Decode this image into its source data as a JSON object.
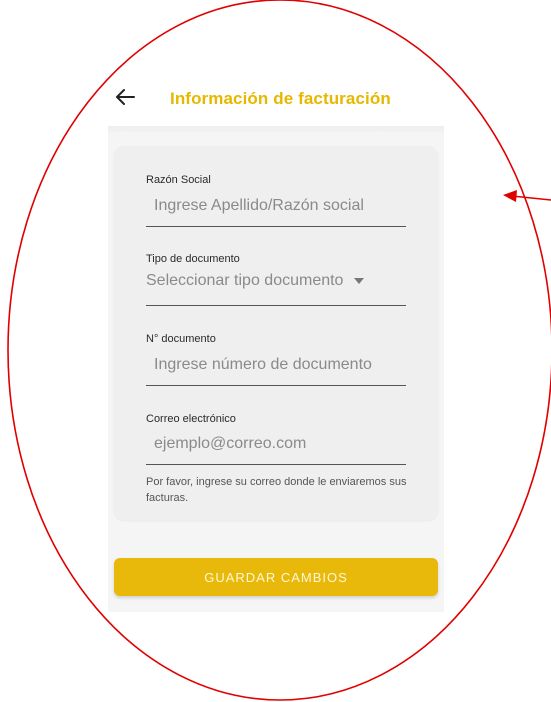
{
  "header": {
    "title": "Información de facturación",
    "back_icon": "arrow-left-icon"
  },
  "form": {
    "razon_social": {
      "label": "Razón Social",
      "placeholder": "Ingrese Apellido/Razón social",
      "value": ""
    },
    "tipo_documento": {
      "label": "Tipo de documento",
      "selected": "Seleccionar tipo documento"
    },
    "numero_documento": {
      "label": "N° documento",
      "placeholder": "Ingrese número de documento",
      "value": ""
    },
    "correo": {
      "label": "Correo electrónico",
      "placeholder": "ejemplo@correo.com",
      "value": "",
      "helper": "Por favor, ingrese su correo donde le enviaremos sus facturas."
    }
  },
  "actions": {
    "save_label": "GUARDAR CAMBIOS"
  },
  "colors": {
    "accent": "#e8b90a",
    "title": "#e6b800",
    "annotation": "#e00000"
  }
}
